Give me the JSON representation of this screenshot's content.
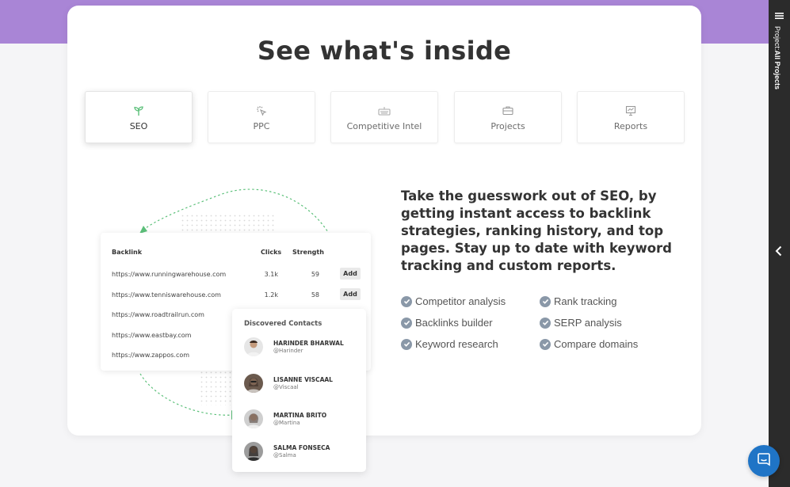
{
  "section": {
    "title": "See what's inside"
  },
  "tabs": [
    {
      "label": "SEO",
      "icon": "seedling-icon",
      "active": true
    },
    {
      "label": "PPC",
      "icon": "cursor-click-icon",
      "active": false
    },
    {
      "label": "Competitive Intel",
      "icon": "keyboard-icon",
      "active": false
    },
    {
      "label": "Projects",
      "icon": "briefcase-icon",
      "active": false
    },
    {
      "label": "Reports",
      "icon": "presentation-chart-icon",
      "active": false
    }
  ],
  "backlinks_table": {
    "headers": {
      "backlink": "Backlink",
      "clicks": "Clicks",
      "strength": "Strength"
    },
    "rows": [
      {
        "url": "https://www.runningwarehouse.com",
        "clicks": "3.1k",
        "strength": "59",
        "action": "Add"
      },
      {
        "url": "https://www.tenniswarehouse.com",
        "clicks": "1.2k",
        "strength": "58",
        "action": "Add"
      },
      {
        "url": "https://www.roadtrailrun.com"
      },
      {
        "url": "https://www.eastbay.com"
      },
      {
        "url": "https://www.zappos.com"
      }
    ]
  },
  "contacts": {
    "title": "Discovered Contacts",
    "items": [
      {
        "name": "HARINDER BHARWAL",
        "handle": "@Harinder"
      },
      {
        "name": "LISANNE VISCAAL",
        "handle": "@Viscaal"
      },
      {
        "name": "MARTINA BRITO",
        "handle": "@Martina"
      },
      {
        "name": "SALMA FONSECA",
        "handle": "@Salma"
      }
    ]
  },
  "description": "Take the guesswork out of SEO, by getting instant access to backlink strategies, ranking history, and top pages. Stay up to date with keyword tracking and custom reports.",
  "features": [
    "Competitor analysis",
    "Rank tracking",
    "Backlinks builder",
    "SERP analysis",
    "Keyword research",
    "Compare domains"
  ],
  "side_panel": {
    "prefix": "Project:",
    "value": "All Projects"
  },
  "colors": {
    "accent_band": "#a985d6",
    "green": "#5cc07a",
    "chat": "#1f74c6",
    "check": "#8a98a8"
  }
}
